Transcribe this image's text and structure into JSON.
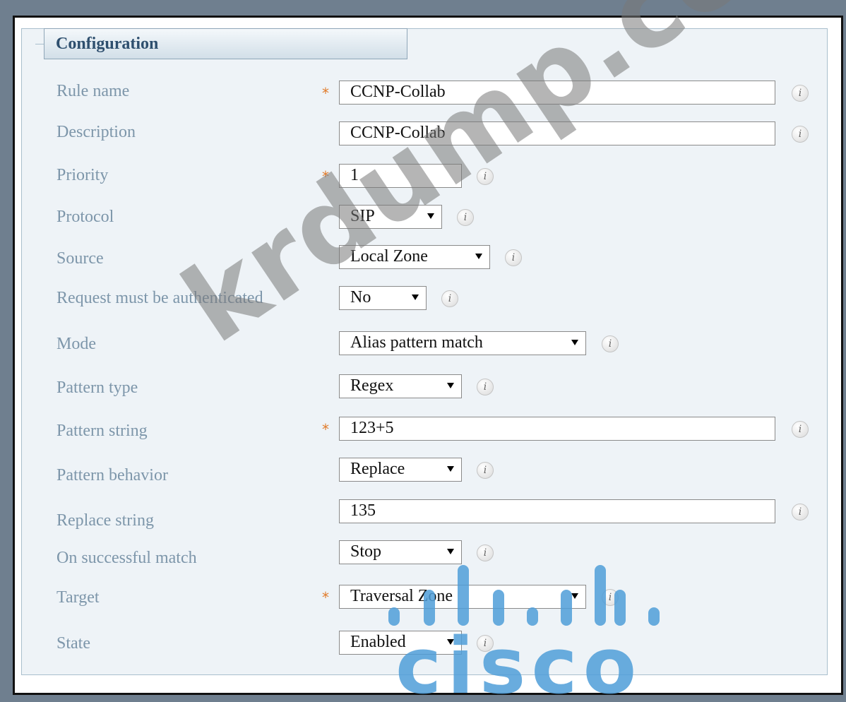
{
  "panel": {
    "title": "Configuration"
  },
  "required_mark": "*",
  "info_glyph": "i",
  "fields": {
    "rule_name": {
      "label": "Rule name",
      "value": "CCNP-Collab"
    },
    "description": {
      "label": "Description",
      "value": "CCNP-Collab"
    },
    "priority": {
      "label": "Priority",
      "value": "1"
    },
    "protocol": {
      "label": "Protocol",
      "value": "SIP"
    },
    "source": {
      "label": "Source",
      "value": "Local Zone"
    },
    "auth": {
      "label": "Request must be authenticated",
      "value": "No"
    },
    "mode": {
      "label": "Mode",
      "value": "Alias pattern match"
    },
    "pattern_type": {
      "label": "Pattern type",
      "value": "Regex"
    },
    "pattern_string": {
      "label": "Pattern string",
      "value": "123+5"
    },
    "pattern_behavior": {
      "label": "Pattern behavior",
      "value": "Replace"
    },
    "replace_string": {
      "label": "Replace string",
      "value": "135"
    },
    "on_match": {
      "label": "On successful match",
      "value": "Stop"
    },
    "target": {
      "label": "Target",
      "value": "Traversal Zone"
    },
    "state": {
      "label": "State",
      "value": "Enabled"
    }
  },
  "watermark": {
    "text": "krdump.com",
    "logo_text": "cisco"
  },
  "colors": {
    "label": "#7d96aa",
    "required": "#e07b2a",
    "cisco_blue": "#4f9ed8"
  }
}
